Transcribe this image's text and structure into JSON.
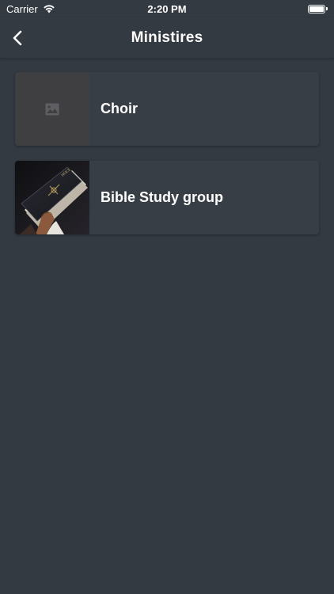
{
  "status_bar": {
    "carrier": "Carrier",
    "time": "2:20 PM"
  },
  "nav": {
    "title": "Ministires",
    "back_icon": "chevron-left-icon"
  },
  "ministries": [
    {
      "name": "Choir",
      "thumbnail": "image-placeholder-icon"
    },
    {
      "name": "Bible Study group",
      "thumbnail": "bible-photo"
    }
  ],
  "colors": {
    "background": "#343a42",
    "card": "#383e46",
    "text": "#ffffff"
  }
}
